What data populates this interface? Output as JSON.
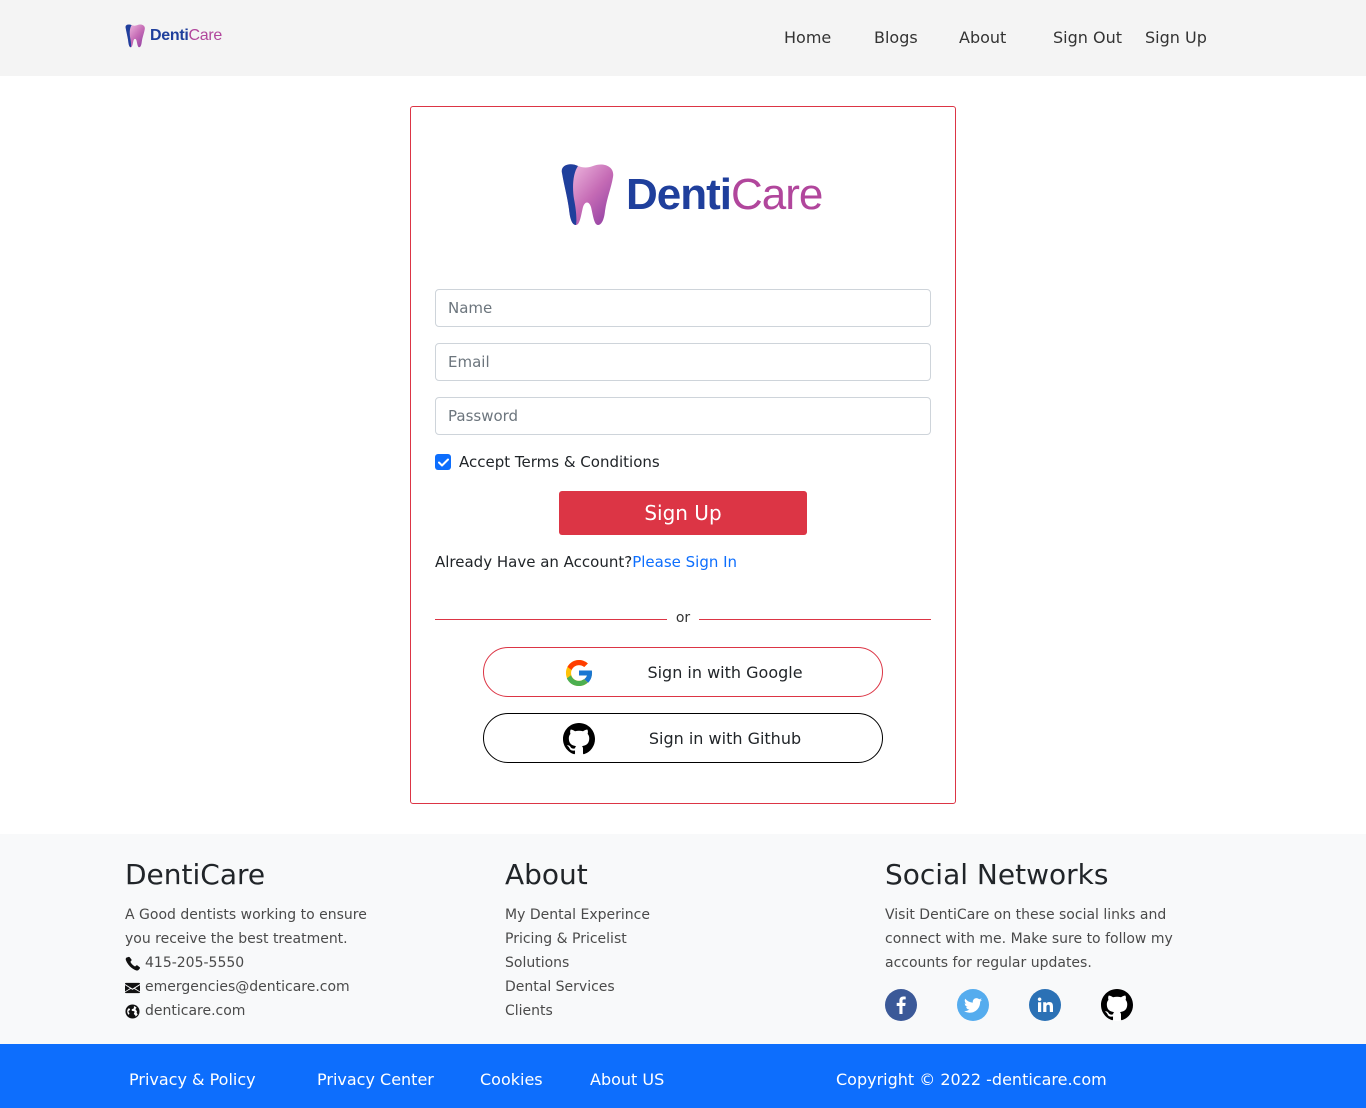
{
  "brand": {
    "part1": "Denti",
    "part2": "Care"
  },
  "nav": {
    "home": "Home",
    "blogs": "Blogs",
    "about": "About",
    "signout": "Sign Out",
    "signup": "Sign Up"
  },
  "form": {
    "name_placeholder": "Name",
    "email_placeholder": "Email",
    "password_placeholder": "Password",
    "terms_label": "Accept Terms & Conditions",
    "terms_checked": true,
    "submit_label": "Sign Up",
    "have_account": "Already Have an Account?",
    "signin_link": "Please Sign In",
    "or": "or",
    "google_label": "Sign in with Google",
    "github_label": "Sign in with Github"
  },
  "footer": {
    "col1": {
      "title": "DentiCare",
      "desc": "A Good dentists working to ensure you receive the best treatment.",
      "phone": "415-205-5550",
      "email": "emergencies@denticare.com",
      "web": "denticare.com"
    },
    "col2": {
      "title": "About",
      "items": [
        "My Dental Experince",
        "Pricing & Pricelist",
        "Solutions",
        "Dental Services",
        "Clients"
      ]
    },
    "col3": {
      "title": "Social Networks",
      "desc": "Visit DentiCare on these social links and connect with me. Make sure to follow my accounts for regular updates."
    }
  },
  "bottom": {
    "links": [
      "Privacy & Policy",
      "Privacy Center",
      "Cookies",
      "About US"
    ],
    "copyright": "Copyright © 2022 -denticare.com"
  },
  "colors": {
    "primary": "#0d6efd",
    "danger": "#dc3545",
    "brand_blue": "#1f3f9c",
    "brand_pink": "#b1469c"
  }
}
